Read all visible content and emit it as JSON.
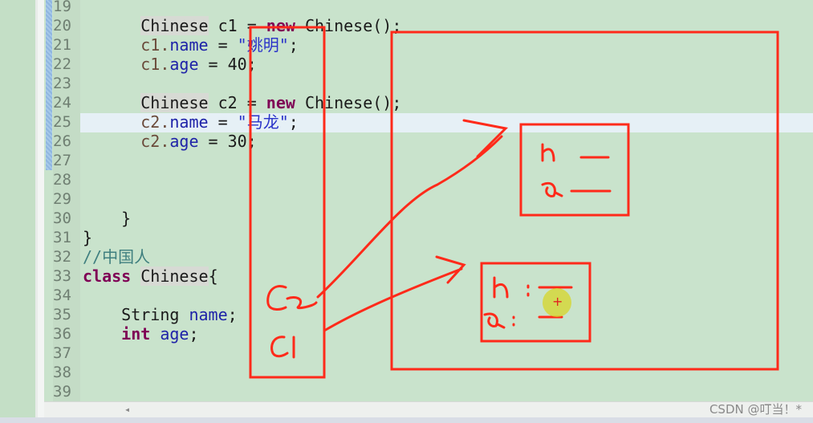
{
  "editor": {
    "lines": [
      {
        "n": "19",
        "code": []
      },
      {
        "n": "20",
        "code": [
          [
            "      ",
            ""
          ],
          [
            "Chinese",
            "typ"
          ],
          [
            " c1 = ",
            ""
          ],
          [
            "new",
            "kw"
          ],
          [
            " Chinese();",
            ""
          ]
        ]
      },
      {
        "n": "21",
        "code": [
          [
            "      ",
            ""
          ],
          [
            "c1.",
            "var"
          ],
          [
            "name",
            "fld"
          ],
          [
            " = ",
            ""
          ],
          [
            "\"姚明\"",
            "str"
          ],
          [
            ";",
            ""
          ]
        ]
      },
      {
        "n": "22",
        "code": [
          [
            "      ",
            ""
          ],
          [
            "c1.",
            "var"
          ],
          [
            "age",
            "fld"
          ],
          [
            " = 40;",
            ""
          ]
        ]
      },
      {
        "n": "23",
        "code": []
      },
      {
        "n": "24",
        "code": [
          [
            "      ",
            ""
          ],
          [
            "Chinese",
            "typ"
          ],
          [
            " c2 = ",
            ""
          ],
          [
            "new",
            "kw"
          ],
          [
            " Chinese();",
            ""
          ]
        ]
      },
      {
        "n": "25",
        "code": [
          [
            "      ",
            ""
          ],
          [
            "c2.",
            "var"
          ],
          [
            "name",
            "fld"
          ],
          [
            " = ",
            ""
          ],
          [
            "\"马龙\"",
            "str"
          ],
          [
            ";",
            ""
          ]
        ]
      },
      {
        "n": "26",
        "code": [
          [
            "      ",
            ""
          ],
          [
            "c2.",
            "var"
          ],
          [
            "age",
            "fld"
          ],
          [
            " = 30;",
            ""
          ]
        ]
      },
      {
        "n": "27",
        "code": []
      },
      {
        "n": "28",
        "code": []
      },
      {
        "n": "29",
        "code": []
      },
      {
        "n": "30",
        "code": [
          [
            "    }",
            ""
          ]
        ]
      },
      {
        "n": "31",
        "code": [
          [
            "}",
            ""
          ]
        ]
      },
      {
        "n": "32",
        "code": [
          [
            "//中国人",
            "cmt"
          ]
        ]
      },
      {
        "n": "33",
        "code": [
          [
            "class",
            "kw"
          ],
          [
            " ",
            ""
          ],
          [
            "Chinese",
            "typ"
          ],
          [
            "{",
            ""
          ]
        ]
      },
      {
        "n": "34",
        "code": []
      },
      {
        "n": "35",
        "code": [
          [
            "    String ",
            ""
          ],
          [
            "name",
            "fld"
          ],
          [
            ";",
            ""
          ]
        ]
      },
      {
        "n": "36",
        "code": [
          [
            "    ",
            ""
          ],
          [
            "int",
            "kw"
          ],
          [
            " ",
            ""
          ],
          [
            "age",
            "fld"
          ],
          [
            ";",
            ""
          ]
        ]
      },
      {
        "n": "37",
        "code": []
      },
      {
        "n": "38",
        "code": []
      },
      {
        "n": "39",
        "code": []
      }
    ],
    "current_line": "25"
  },
  "annotation_color": "#ff2a1a",
  "watermark": "CSDN @叮当！*"
}
